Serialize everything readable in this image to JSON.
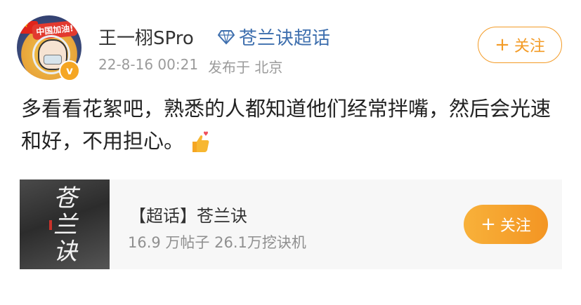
{
  "post": {
    "author": {
      "name": "王一栩SPro",
      "avatar_banner": "中国加油!",
      "verified_icon": "v-badge-icon"
    },
    "topic_tag": {
      "icon": "diamond-icon",
      "label": "苍兰诀超话"
    },
    "timestamp": "22-8-16 00:21",
    "location": "发布于 北京",
    "follow_button": {
      "plus": "+",
      "label": "关注"
    },
    "text": "多看看花絮吧，熟悉的人都知道他们经常拌嘴，然后会光速和好，不用担心。",
    "emoji": "thumbs-up-heart-emoji"
  },
  "card": {
    "cover_text": "苍兰诀",
    "title": "【超话】苍兰诀",
    "stats": "16.9 万帖子 26.1万挖诀机",
    "follow_button": {
      "plus": "+",
      "label": "关注"
    }
  },
  "colors": {
    "accent": "#f39b26",
    "topic_link": "#3e6fae",
    "meta_text": "#9b9b9b"
  }
}
